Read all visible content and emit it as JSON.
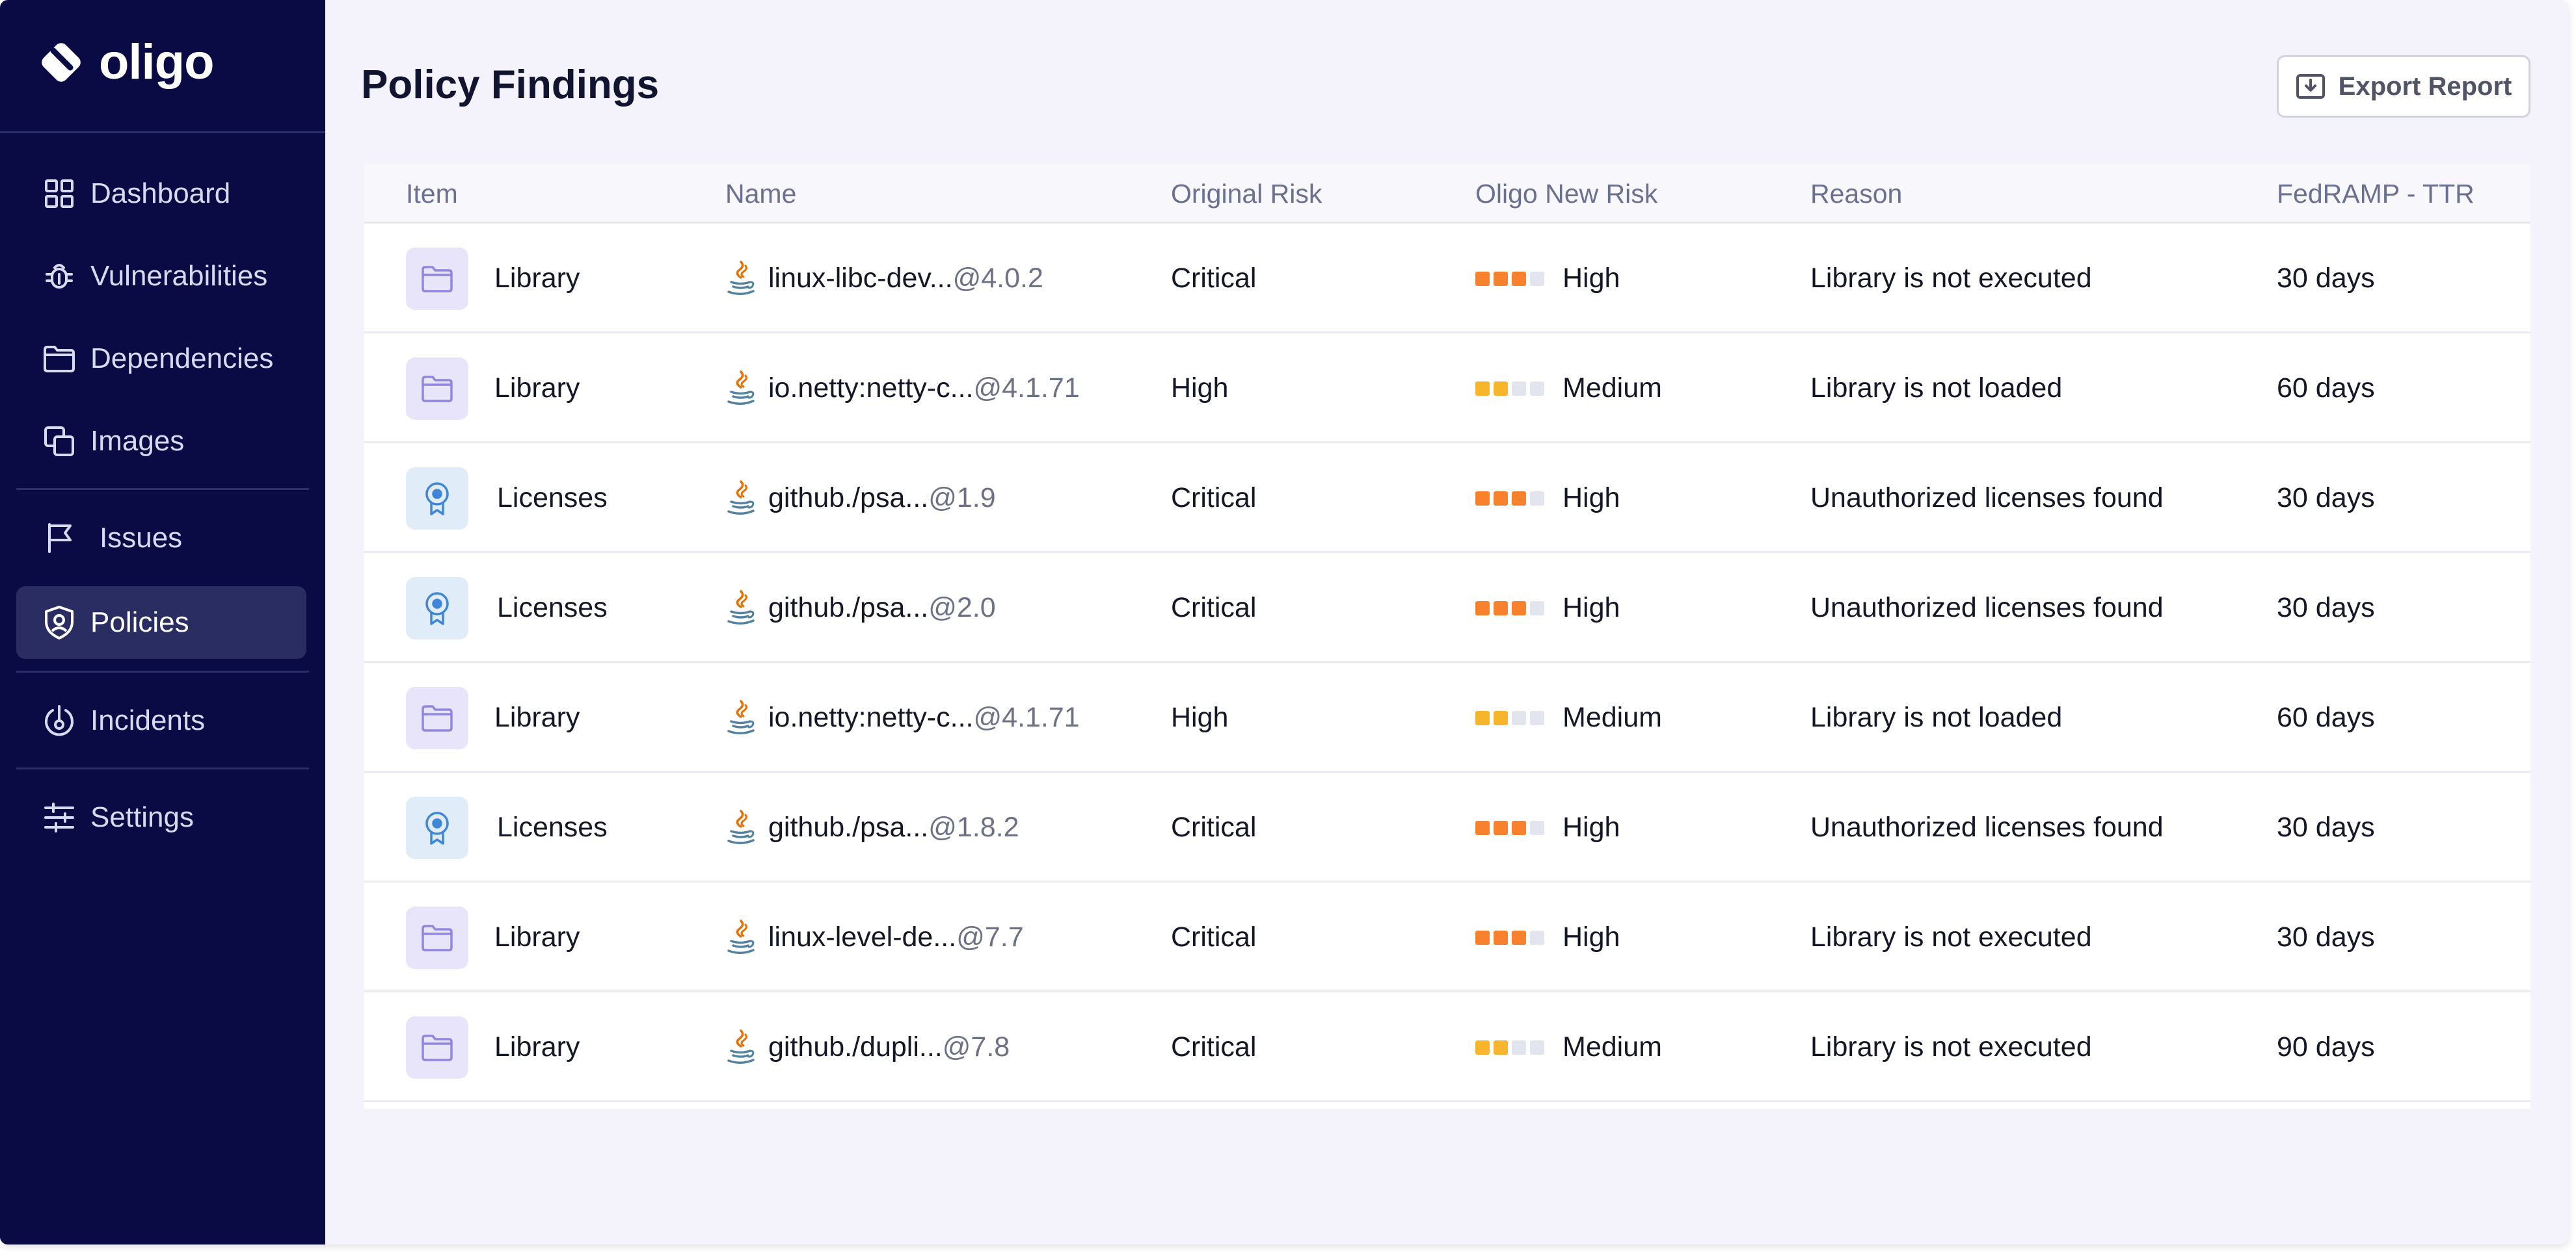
{
  "brand": {
    "name": "oligo"
  },
  "sidebar": {
    "items": [
      {
        "label": "Dashboard",
        "icon": "grid-icon"
      },
      {
        "label": "Vulnerabilities",
        "icon": "bug-icon"
      },
      {
        "label": "Dependencies",
        "icon": "folder-icon"
      },
      {
        "label": "Images",
        "icon": "images-icon"
      },
      {
        "label": "Issues",
        "icon": "flag-icon"
      },
      {
        "label": "Policies",
        "icon": "shield-icon",
        "active": true
      },
      {
        "label": "Incidents",
        "icon": "incident-icon"
      },
      {
        "label": "Settings",
        "icon": "sliders-icon"
      }
    ]
  },
  "page": {
    "title": "Policy Findings",
    "export_label": "Export Report"
  },
  "table": {
    "columns": [
      "Item",
      "Name",
      "Original Risk",
      "Oligo New Risk",
      "Reason",
      "FedRAMP - TTR"
    ],
    "rows": [
      {
        "item": "Library",
        "type": "library",
        "name": "linux-libc-dev...",
        "version": "@4.0.2",
        "original_risk": "Critical",
        "new_risk": "High",
        "level": 3,
        "reason": "Library is not executed",
        "ttr": "30 days"
      },
      {
        "item": "Library",
        "type": "library",
        "name": "io.netty:netty-c...",
        "version": "@4.1.71",
        "original_risk": "High",
        "new_risk": "Medium",
        "level": 2,
        "reason": "Library is not loaded",
        "ttr": "60 days"
      },
      {
        "item": "Licenses",
        "type": "license",
        "name": "github./psa...",
        "version": "@1.9",
        "original_risk": "Critical",
        "new_risk": "High",
        "level": 3,
        "reason": "Unauthorized licenses found",
        "ttr": "30 days"
      },
      {
        "item": "Licenses",
        "type": "license",
        "name": "github./psa...",
        "version": "@2.0",
        "original_risk": "Critical",
        "new_risk": "High",
        "level": 3,
        "reason": "Unauthorized licenses found",
        "ttr": "30 days"
      },
      {
        "item": "Library",
        "type": "library",
        "name": "io.netty:netty-c...",
        "version": "@4.1.71",
        "original_risk": "High",
        "new_risk": "Medium",
        "level": 2,
        "reason": "Library is not loaded",
        "ttr": "60 days"
      },
      {
        "item": "Licenses",
        "type": "license",
        "name": "github./psa...",
        "version": "@1.8.2",
        "original_risk": "Critical",
        "new_risk": "High",
        "level": 3,
        "reason": "Unauthorized licenses found",
        "ttr": "30 days"
      },
      {
        "item": "Library",
        "type": "library",
        "name": "linux-level-de...",
        "version": "@7.7",
        "original_risk": "Critical",
        "new_risk": "High",
        "level": 3,
        "reason": "Library is not executed",
        "ttr": "30 days"
      },
      {
        "item": "Library",
        "type": "library",
        "name": "github./dupli...",
        "version": "@7.8",
        "original_risk": "Critical",
        "new_risk": "Medium",
        "level": 2,
        "reason": "Library is not executed",
        "ttr": "90 days"
      }
    ]
  },
  "colors": {
    "sidebar_bg": "#0a0a45",
    "active_bg": "#2a2d62",
    "risk_high": "#f7812c",
    "risk_medium": "#f7b52b",
    "risk_off": "#e3e5ee",
    "library_icon": "#8f86e0",
    "license_icon": "#3f86d9"
  }
}
